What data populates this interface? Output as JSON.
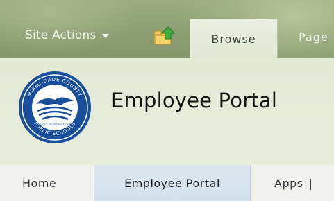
{
  "ribbon": {
    "site_actions_label": "Site Actions",
    "tabs": [
      {
        "label": "Browse",
        "selected": true
      },
      {
        "label": "Page"
      }
    ],
    "nav_up_icon": "folder-up-arrow-icon"
  },
  "header": {
    "site_title": "Employee Portal",
    "logo": {
      "ring_text_top": "MIAMI-DADE COUNTY",
      "ring_text_bottom": "PUBLIC SCHOOLS",
      "motto": "giving our students the world"
    }
  },
  "topnav": {
    "items": [
      {
        "label": "Home"
      },
      {
        "label": "Employee Portal",
        "selected": true
      },
      {
        "label": "Apps",
        "separator": "|"
      }
    ]
  },
  "colors": {
    "ribbon": "#8e9f74",
    "title_area": "#e5ebd8",
    "selected_nav": "#d8e3ee",
    "logo_blue": "#1a4f9c"
  }
}
